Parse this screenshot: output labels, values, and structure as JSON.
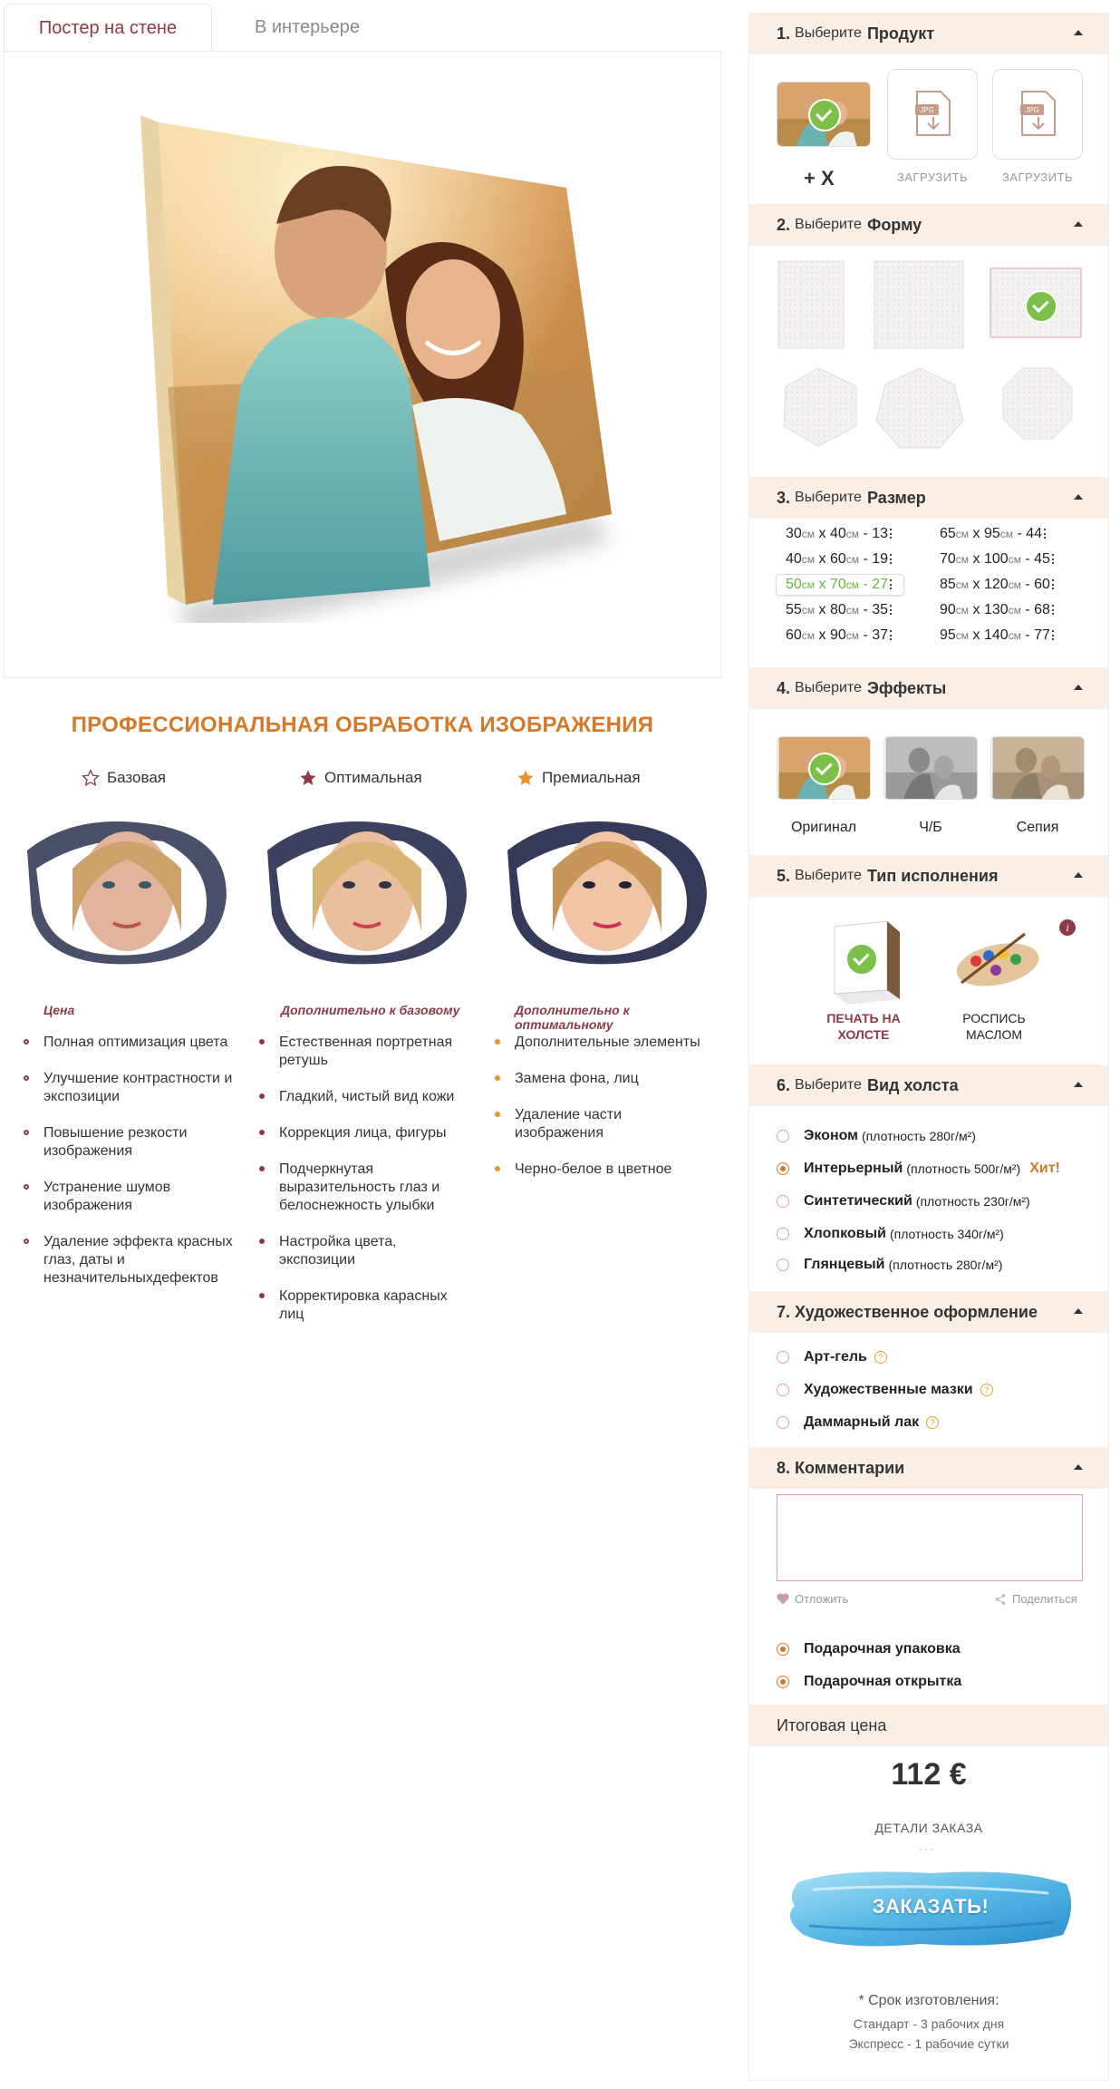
{
  "tabs": {
    "poster": "Постер на стене",
    "interior": "В интерьере"
  },
  "processing": {
    "title": "ПРОФЕССИОНАЛЬНАЯ ОБРАБОТКА ИЗОБРАЖЕНИЯ",
    "tiers": [
      {
        "name": "Базовая",
        "head": "Цена",
        "items": [
          "Полная оптимизация цвета",
          "Улучшение контрастности и экспозиции",
          "Повышение резкости изображения",
          "Устранение шумов изображения",
          "Удаление эффекта красных глаз, даты и незначительныхдефектов"
        ]
      },
      {
        "name": "Оптимальная",
        "head": "Дополнительно к базовому",
        "items": [
          "Естественная портретная ретушь",
          "Гладкий, чистый вид кожи",
          "Коррекция лица, фигуры",
          "Подчеркнутая выразительность глаз и белоснежность улыбки",
          "Настройка цвета, экспозиции",
          "Корректировка карасных лиц"
        ]
      },
      {
        "name": "Премиальная",
        "head": "Дополнительно к оптимальному",
        "items": [
          "Дополнительные элементы",
          "Замена фона, лиц",
          "Удаление части изображения",
          "Черно-белое в цветное"
        ]
      }
    ]
  },
  "sidebar": {
    "choose": "Выберите",
    "s1": {
      "num": "1.",
      "title": "Продукт",
      "plus": "+ X",
      "upload1": "ЗАГРУЗИТЬ",
      "upload2": "ЗАГРУЗИТЬ",
      "file_badge": "JPG"
    },
    "s2": {
      "num": "2.",
      "title": "Форму"
    },
    "s3": {
      "num": "3.",
      "title": "Размер",
      "sizes_left": [
        {
          "w": "30",
          "h": "40",
          "p": "13"
        },
        {
          "w": "40",
          "h": "60",
          "p": "19"
        },
        {
          "w": "50",
          "h": "70",
          "p": "27"
        },
        {
          "w": "55",
          "h": "80",
          "p": "35"
        },
        {
          "w": "60",
          "h": "90",
          "p": "37"
        }
      ],
      "sizes_right": [
        {
          "w": "65",
          "h": "95",
          "p": "44"
        },
        {
          "w": "70",
          "h": "100",
          "p": "45"
        },
        {
          "w": "85",
          "h": "120",
          "p": "60"
        },
        {
          "w": "90",
          "h": "130",
          "p": "68"
        },
        {
          "w": "95",
          "h": "140",
          "p": "77"
        }
      ],
      "unit": "см",
      "x": "x",
      "dash": "-"
    },
    "s4": {
      "num": "4.",
      "title": "Эффекты",
      "effects": [
        "Оригинал",
        "Ч/Б",
        "Сепия"
      ]
    },
    "s5": {
      "num": "5.",
      "title": "Тип исполнения",
      "opt1": "ПЕЧАТЬ НА ХОЛСТЕ",
      "opt2": "РОСПИСЬ МАСЛОМ",
      "info": "i"
    },
    "s6": {
      "num": "6.",
      "title": "Вид холста",
      "options": [
        {
          "name": "Эконом",
          "note": "(плотность 280г/м²)"
        },
        {
          "name": "Интерьерный",
          "note": "(плотность 500г/м²)"
        },
        {
          "name": "Синтетический",
          "note": "(плотность 230г/м²)"
        },
        {
          "name": "Хлопковый",
          "note": "(плотность 340г/м²)"
        },
        {
          "name": "Глянцевый",
          "note": "(плотность 280г/м²)"
        }
      ],
      "hit": "Хит!"
    },
    "s7": {
      "num": "7.",
      "title": "Художественное оформление",
      "options": [
        "Арт-гель",
        "Художественные мазки",
        "Даммарный лак"
      ],
      "q": "?"
    },
    "s8": {
      "num": "8.",
      "title": "Комментарии",
      "postpone": "Отложить",
      "share": "Поделиться",
      "gift_pack": "Подарочная упаковка",
      "gift_card": "Подарочная открытка"
    },
    "total": {
      "title": "Итоговая цена",
      "price": "112 €",
      "details": "ДЕТАЛИ ЗАКАЗА",
      "order": "ЗАКАЗАТЬ!",
      "term_title": "* Срок изготовления:",
      "standard": "Стандарт - 3 рабочих дня",
      "express": "Экспресс - 1 рабочие сутки"
    }
  },
  "colors": {
    "accent": "#d4782a",
    "wine": "#8b3a46",
    "header_bg": "#fbeee4",
    "check": "#7cbf4a"
  }
}
